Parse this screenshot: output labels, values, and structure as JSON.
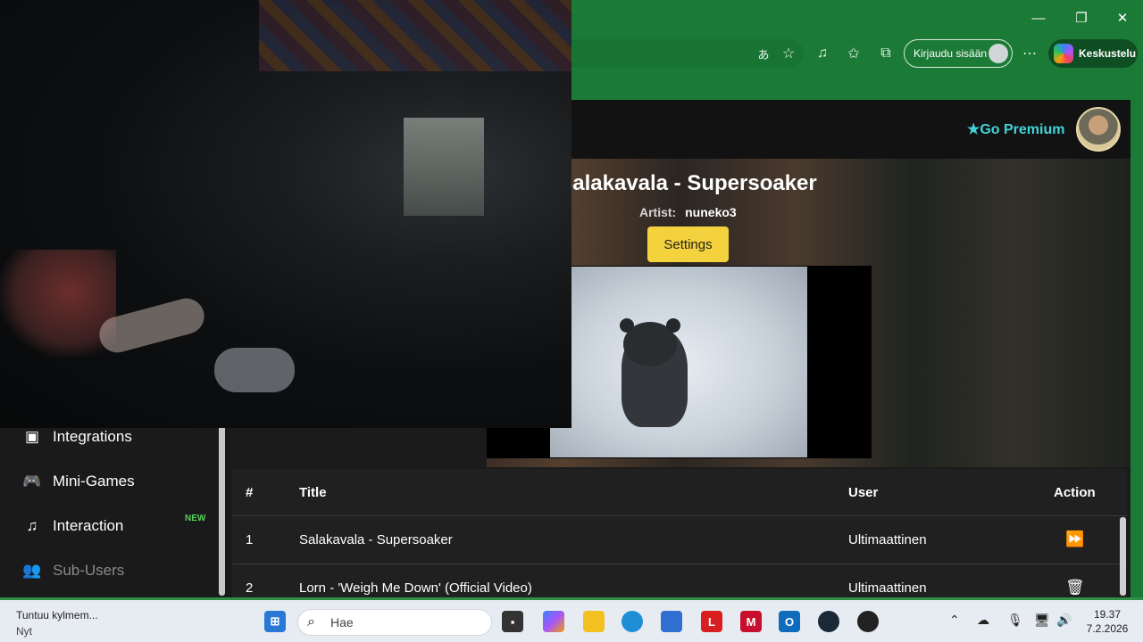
{
  "browser": {
    "window_controls": {
      "minimize": "—",
      "restore": "❐",
      "close": "✕"
    },
    "signin_label": "Kirjaudu sisään",
    "copilot_label": "Keskustelu"
  },
  "page": {
    "premium_label": "★Go Premium",
    "song_title": "Salakavala - Supersoaker",
    "artist_label": "Artist:",
    "artist_name": "nuneko3",
    "settings_label": "Settings"
  },
  "sidebar": {
    "items": [
      {
        "label": "Integrations",
        "icon": "discord-icon",
        "glyph": "▣"
      },
      {
        "label": "Mini-Games",
        "icon": "gamepad-icon",
        "glyph": "🎮"
      },
      {
        "label": "Interaction",
        "icon": "music-note-icon",
        "glyph": "♫"
      },
      {
        "label": "Sub-Users",
        "icon": "users-icon",
        "glyph": "👥"
      }
    ],
    "new_badge": "NEW"
  },
  "queue": {
    "headers": {
      "num": "#",
      "title": "Title",
      "user": "User",
      "action": "Action"
    },
    "rows": [
      {
        "num": "1",
        "title": "Salakavala - Supersoaker",
        "user": "Ultimaattinen",
        "action": "skip-icon"
      },
      {
        "num": "2",
        "title": "Lorn - 'Weigh Me Down' (Official Video)",
        "user": "Ultimaattinen",
        "action": "trash-icon"
      }
    ]
  },
  "taskbar": {
    "weather_title": "Tuntuu kylmem...",
    "weather_sub": "Nyt",
    "search_placeholder": "Hae",
    "time": "19.37",
    "date": "7.2.2026"
  },
  "colors": {
    "browser_green": "#1c7a37",
    "premium_cyan": "#42d3d8",
    "settings_yellow": "#f4d23e",
    "new_green": "#5ad25a"
  }
}
